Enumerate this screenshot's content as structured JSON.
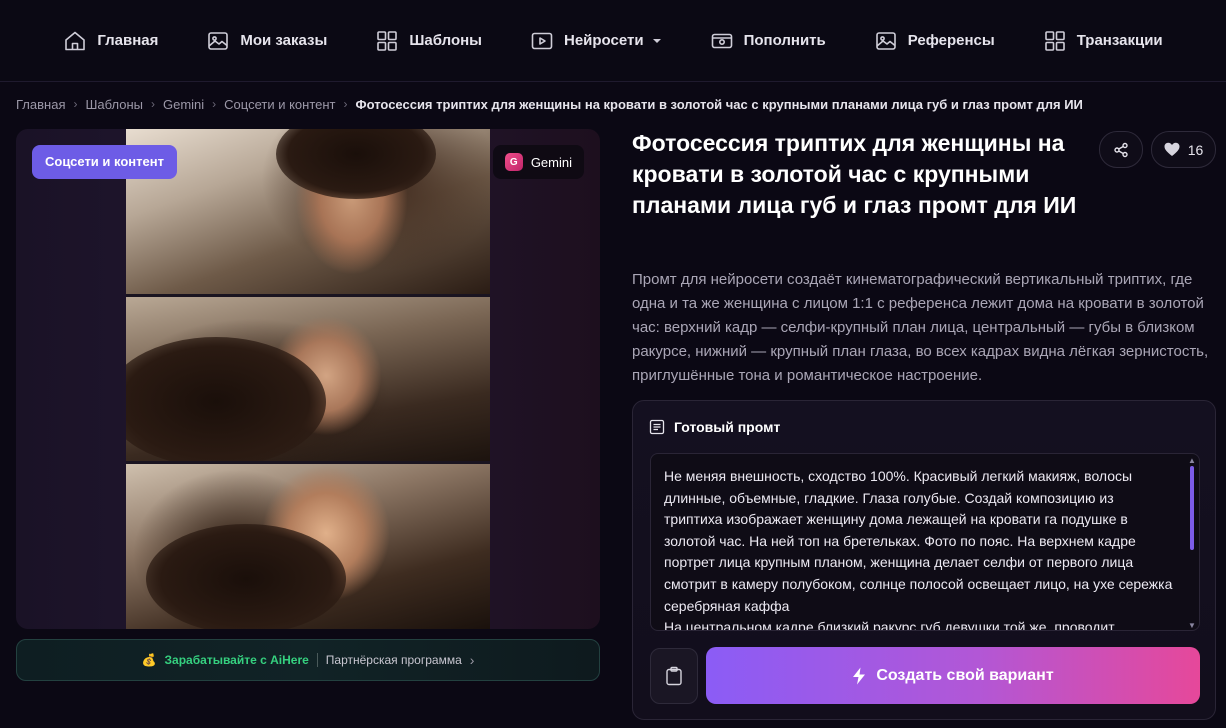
{
  "nav": {
    "items": [
      {
        "label": "Главная",
        "icon": "home-icon"
      },
      {
        "label": "Мои заказы",
        "icon": "image-icon"
      },
      {
        "label": "Шаблоны",
        "icon": "grid-icon"
      },
      {
        "label": "Нейросети",
        "icon": "play-icon",
        "dropdown": true
      },
      {
        "label": "Пополнить",
        "icon": "wallet-icon"
      },
      {
        "label": "Референсы",
        "icon": "picture-icon"
      },
      {
        "label": "Транзакции",
        "icon": "grid-icon"
      }
    ]
  },
  "breadcrumb": {
    "items": [
      "Главная",
      "Шаблоны",
      "Gemini",
      "Соцсети и контент"
    ],
    "current": "Фотосессия триптих для женщины на кровати в золотой час с крупными планами лица губ и глаз промт для ИИ"
  },
  "image": {
    "category_badge": "Соцсети и контент",
    "model_badge": "Gemini",
    "model_icon_letter": "G"
  },
  "affiliate": {
    "emoji": "💰",
    "earn": "Зарабатывайте с AiHere",
    "program": "Партнёрская программа"
  },
  "template": {
    "title": "Фотосессия триптих для женщины на кровати в золотой час с крупными планами лица губ и глаз промт для ИИ",
    "likes": "16",
    "description": "Промт для нейросети создаёт кинематографический вертикальный триптих, где одна и та же женщина с лицом 1:1 с референса лежит дома на кровати в золотой час: верхний кадр — селфи-крупный план лица, центральный — губы в близком ракурсе, нижний — крупный план глаза, во всех кадрах видна лёгкая зернистость, приглушённые тона и романтическое настроение."
  },
  "prompt": {
    "header": "Готовый промт",
    "text": "Не меняя внешность, сходство 100%. Красивый легкий макияж, волосы длинные, объемные, гладкие. Глаза голубые. Создай композицию из триптиха изображает женщину дома лежащей на кровати га подушке в золотой час. На ней топ на бретельках. Фото по пояс. На верхнем кадре портрет лица крупным планом, женщина делает селфи от первого лица смотрит в камеру полубоком, солнце полосой освещает лицо, на ухе сережка серебряная каффа\nНа центральном кадре близкий ракурс губ девушки той же, проводит",
    "create_label": "Создать свой вариант"
  },
  "colors": {
    "accent": "#6d5ce6",
    "gradient_start": "#8b5cf6",
    "gradient_end": "#e6489a",
    "affiliate_green": "#35d07f"
  }
}
